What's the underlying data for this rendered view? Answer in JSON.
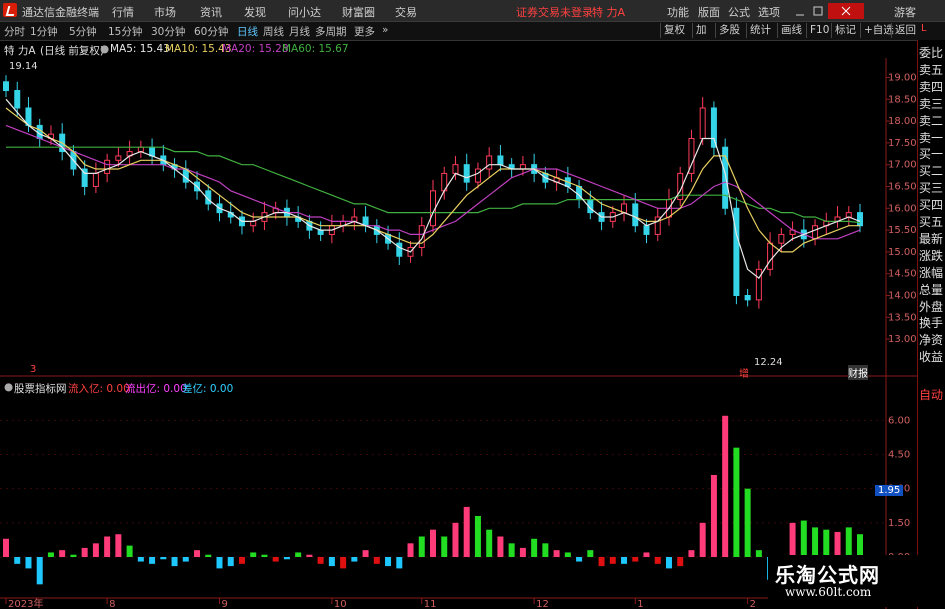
{
  "menu": {
    "app_title": "通达信金融终端",
    "items": [
      "行情",
      "市场",
      "资讯",
      "发现",
      "问小达",
      "财富圈",
      "交易"
    ],
    "login_status": "证券交易未登录",
    "stock": "特 力A",
    "right_items": [
      "功能",
      "版面",
      "公式",
      "选项"
    ],
    "guest": "游客"
  },
  "toolbar": {
    "periods": [
      "分时",
      "1分钟",
      "5分钟",
      "15分钟",
      "30分钟",
      "60分钟",
      "日线",
      "周线",
      "月线",
      "多周期",
      "更多"
    ],
    "selected_period": "日线",
    "right_buttons": [
      "复权",
      "加",
      "多股",
      "统计",
      "画线",
      "F10",
      "标记",
      "+自选",
      "返回"
    ]
  },
  "info": {
    "stock": "特 力A",
    "mode": "(日线 前复权)",
    "ma5": "MA5: 15.43",
    "ma10": "MA10: 15.43",
    "ma20": "MA20: 15.28",
    "ma60": "MA60: 15.67"
  },
  "side_panel": [
    "委比",
    "卖五",
    "卖四",
    "卖三",
    "卖二",
    "卖一",
    "买一",
    "买二",
    "买三",
    "买四",
    "买五",
    "最新",
    "涨跌",
    "涨幅",
    "总量",
    "外盘",
    "换手",
    "净资",
    "收益"
  ],
  "side_panel_auto": "自动",
  "side_top_letter": "L",
  "indicator": {
    "name": "股票指标网",
    "inflow": "流入亿: 0.00",
    "outflow": "流出亿: 0.00",
    "diff": "差亿: 0.00",
    "current_value": "1.95"
  },
  "annotations": {
    "high_label": "19.14",
    "low_label": "12.24",
    "finance_tag": "财报",
    "event_tag": "增",
    "left_marker": "3"
  },
  "watermark": {
    "line1": "乐淘公式网",
    "line2": "www.60lt.com"
  },
  "colors": {
    "up": "#ff3b5a",
    "down": "#35d4e8",
    "ma5": "#e8e8e8",
    "ma10": "#e8d060",
    "ma20": "#c040c0",
    "ma60": "#40b040",
    "bar_pos": "#ff3b7a",
    "bar_neg": "#1ec8ff",
    "bar_green": "#22dd22",
    "bar_red": "#e01010"
  },
  "chart_data": {
    "type": "candlestick+bar",
    "price_axis": {
      "ticks": [
        "19.00",
        "18.50",
        "18.00",
        "17.50",
        "17.00",
        "16.50",
        "16.00",
        "15.50",
        "15.00",
        "14.50",
        "14.00",
        "13.50",
        "13.00"
      ],
      "range": [
        12.2,
        19.4
      ]
    },
    "indicator_axis": {
      "ticks": [
        "6.00",
        "4.50",
        "3.00",
        "1.50",
        "0.00"
      ],
      "range": [
        -1.8,
        7.2
      ]
    },
    "x_labels": [
      "2023年",
      "8",
      "9",
      "10",
      "11",
      "12",
      "1",
      "2"
    ],
    "close_series": [
      18.7,
      18.3,
      17.9,
      17.6,
      17.7,
      17.3,
      16.9,
      16.5,
      16.8,
      17.1,
      17.2,
      17.3,
      17.4,
      17.2,
      17.0,
      16.9,
      16.6,
      16.4,
      16.1,
      15.9,
      15.8,
      15.6,
      15.7,
      15.9,
      16.0,
      15.8,
      15.7,
      15.5,
      15.4,
      15.6,
      15.7,
      15.8,
      15.6,
      15.4,
      15.2,
      14.9,
      15.1,
      15.6,
      16.4,
      16.8,
      17.0,
      16.6,
      16.9,
      17.2,
      17.0,
      16.9,
      17.0,
      16.8,
      16.6,
      16.7,
      16.5,
      16.2,
      15.9,
      15.7,
      15.9,
      16.1,
      15.6,
      15.4,
      15.8,
      16.2,
      16.8,
      17.6,
      18.3,
      17.4,
      16.0,
      14.0,
      13.9,
      14.6,
      15.2,
      15.4,
      15.5,
      15.3,
      15.6,
      15.7,
      15.8,
      15.9,
      15.6
    ],
    "ma5_series": [
      18.5,
      18.2,
      17.9,
      17.7,
      17.6,
      17.4,
      17.1,
      16.8,
      16.8,
      16.9,
      17.0,
      17.2,
      17.3,
      17.2,
      17.1,
      16.9,
      16.7,
      16.5,
      16.2,
      16.0,
      15.9,
      15.7,
      15.7,
      15.8,
      15.9,
      15.9,
      15.8,
      15.6,
      15.5,
      15.5,
      15.6,
      15.7,
      15.6,
      15.5,
      15.3,
      15.1,
      15.0,
      15.3,
      15.9,
      16.4,
      16.8,
      16.7,
      16.8,
      17.0,
      17.0,
      16.9,
      16.9,
      16.9,
      16.7,
      16.6,
      16.5,
      16.3,
      16.0,
      15.8,
      15.8,
      15.9,
      15.8,
      15.6,
      15.7,
      16.0,
      16.4,
      17.0,
      17.6,
      17.6,
      16.8,
      15.4,
      14.6,
      14.4,
      14.8,
      15.1,
      15.3,
      15.4,
      15.5,
      15.6,
      15.7,
      15.8,
      15.7
    ],
    "ma10_series": [
      18.3,
      18.1,
      17.9,
      17.8,
      17.6,
      17.5,
      17.3,
      17.0,
      16.9,
      16.9,
      16.9,
      17.0,
      17.1,
      17.1,
      17.1,
      17.0,
      16.9,
      16.7,
      16.5,
      16.3,
      16.1,
      15.9,
      15.8,
      15.8,
      15.8,
      15.8,
      15.8,
      15.7,
      15.6,
      15.6,
      15.6,
      15.6,
      15.6,
      15.5,
      15.4,
      15.3,
      15.2,
      15.2,
      15.4,
      15.7,
      16.0,
      16.3,
      16.5,
      16.7,
      16.9,
      16.9,
      16.9,
      16.9,
      16.8,
      16.7,
      16.6,
      16.5,
      16.3,
      16.1,
      16.0,
      15.9,
      15.8,
      15.7,
      15.7,
      15.8,
      16.0,
      16.4,
      16.9,
      17.2,
      17.2,
      16.6,
      16.0,
      15.5,
      15.2,
      15.0,
      15.0,
      15.2,
      15.3,
      15.4,
      15.5,
      15.6,
      15.6
    ],
    "ma20_series": [
      17.9,
      17.8,
      17.7,
      17.6,
      17.5,
      17.4,
      17.3,
      17.2,
      17.1,
      17.0,
      17.0,
      17.0,
      17.0,
      17.0,
      17.0,
      16.9,
      16.9,
      16.8,
      16.7,
      16.6,
      16.4,
      16.3,
      16.2,
      16.1,
      16.0,
      15.9,
      15.9,
      15.8,
      15.8,
      15.7,
      15.7,
      15.7,
      15.6,
      15.6,
      15.5,
      15.5,
      15.4,
      15.4,
      15.5,
      15.6,
      15.7,
      15.9,
      16.1,
      16.3,
      16.5,
      16.7,
      16.8,
      16.9,
      16.9,
      16.9,
      16.8,
      16.7,
      16.6,
      16.5,
      16.4,
      16.3,
      16.2,
      16.1,
      16.0,
      16.0,
      16.0,
      16.1,
      16.3,
      16.5,
      16.6,
      16.5,
      16.3,
      16.1,
      15.9,
      15.7,
      15.5,
      15.4,
      15.3,
      15.3,
      15.3,
      15.4,
      15.5
    ],
    "ma60_series": [
      17.4,
      17.4,
      17.4,
      17.4,
      17.4,
      17.4,
      17.4,
      17.4,
      17.4,
      17.4,
      17.4,
      17.4,
      17.4,
      17.4,
      17.4,
      17.3,
      17.3,
      17.3,
      17.2,
      17.2,
      17.1,
      17.0,
      17.0,
      16.9,
      16.8,
      16.7,
      16.6,
      16.5,
      16.4,
      16.3,
      16.2,
      16.1,
      16.1,
      16.0,
      15.9,
      15.9,
      15.9,
      15.9,
      15.9,
      15.9,
      15.9,
      15.9,
      15.9,
      16.0,
      16.0,
      16.0,
      16.1,
      16.1,
      16.1,
      16.1,
      16.2,
      16.2,
      16.2,
      16.2,
      16.2,
      16.2,
      16.2,
      16.2,
      16.2,
      16.2,
      16.3,
      16.3,
      16.3,
      16.3,
      16.3,
      16.2,
      16.1,
      16.0,
      16.0,
      15.9,
      15.9,
      15.8,
      15.8,
      15.7,
      15.7,
      15.7,
      15.67
    ],
    "indicator_values": [
      0.8,
      -0.3,
      -0.5,
      -1.2,
      0.2,
      0.3,
      0.1,
      0.4,
      0.6,
      0.9,
      1.0,
      0.5,
      -0.2,
      -0.3,
      -0.1,
      -0.4,
      -0.2,
      0.3,
      0.1,
      -0.5,
      -0.4,
      -0.3,
      0.2,
      0.1,
      -0.2,
      -0.1,
      0.2,
      0.1,
      -0.3,
      -0.4,
      -0.5,
      -0.2,
      0.3,
      -0.3,
      -0.4,
      -0.5,
      0.6,
      0.9,
      1.2,
      0.9,
      1.5,
      2.2,
      1.8,
      1.2,
      0.9,
      0.6,
      0.4,
      0.8,
      0.6,
      0.3,
      0.2,
      -0.2,
      0.3,
      -0.4,
      -0.3,
      -0.3,
      -0.2,
      0.2,
      -0.3,
      -0.5,
      -0.4,
      0.3,
      1.5,
      3.6,
      6.2,
      4.8,
      3.0,
      0.3,
      -1.0,
      -1.8,
      1.5,
      1.6,
      1.3,
      1.2,
      1.1,
      1.3,
      1.0
    ],
    "indicator_colors": [
      "pos",
      "neg",
      "neg",
      "neg",
      "green",
      "pos",
      "green",
      "pos",
      "pos",
      "pos",
      "pos",
      "green",
      "neg",
      "neg",
      "neg",
      "neg",
      "neg",
      "pos",
      "green",
      "neg",
      "neg",
      "red",
      "green",
      "green",
      "red",
      "neg",
      "green",
      "pos",
      "red",
      "neg",
      "red",
      "neg",
      "pos",
      "red",
      "neg",
      "neg",
      "pos",
      "green",
      "pos",
      "green",
      "pos",
      "pos",
      "green",
      "green",
      "pos",
      "green",
      "pos",
      "green",
      "green",
      "pos",
      "green",
      "neg",
      "green",
      "red",
      "red",
      "neg",
      "red",
      "pos",
      "red",
      "neg",
      "red",
      "pos",
      "pos",
      "pos",
      "pos",
      "green",
      "green",
      "green",
      "neg",
      "neg",
      "pos",
      "green",
      "green",
      "green",
      "pos",
      "green",
      "green"
    ]
  }
}
